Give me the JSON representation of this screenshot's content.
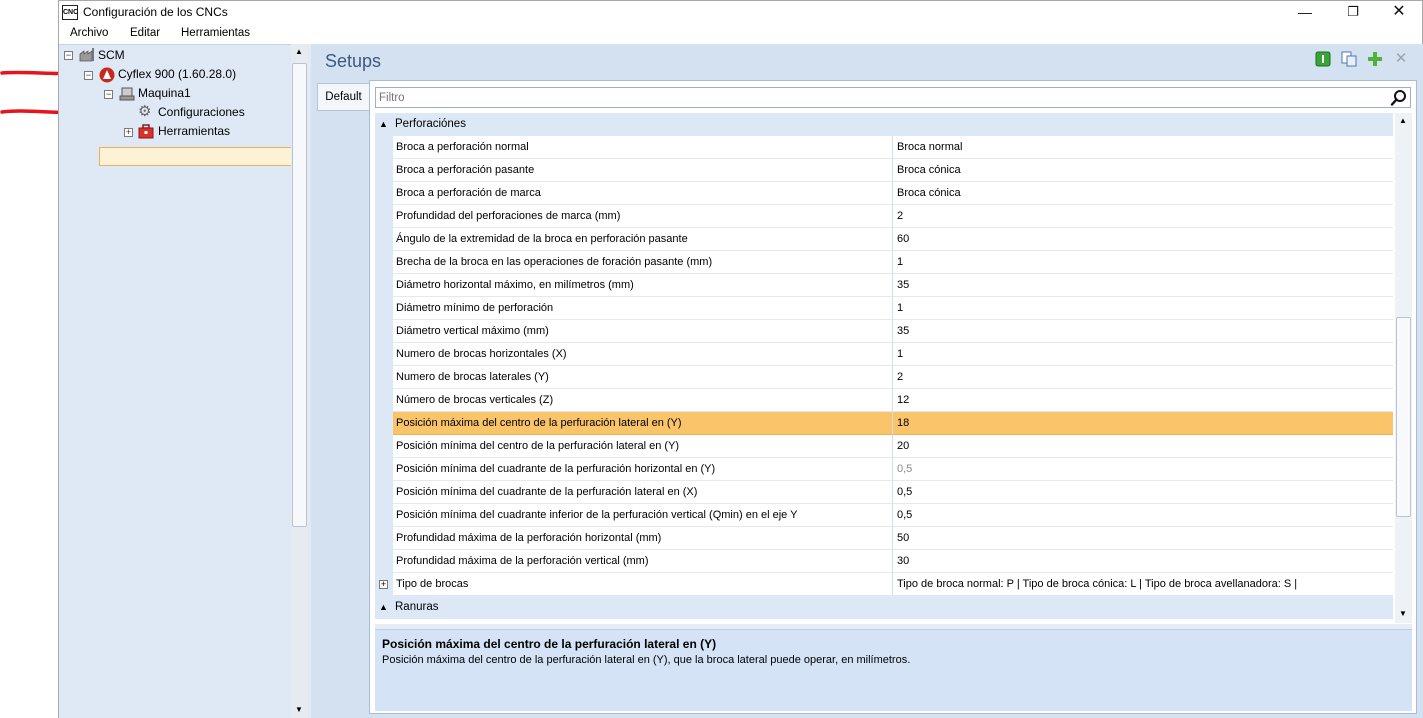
{
  "window": {
    "title": "Configuración de los CNCs",
    "app_icon_text": "CNC"
  },
  "menu": [
    "Archivo",
    "Editar",
    "Herramientas"
  ],
  "tree": {
    "root": "SCM",
    "cyflex": "Cyflex 900 (1.60.28.0)",
    "machine": "Maquina1",
    "configurations": "Configuraciones",
    "tools": "Herramientas"
  },
  "setups": {
    "title": "Setups",
    "tab": "Default",
    "filter_placeholder": "Filtro"
  },
  "grid": {
    "group1": "Perforaciónes",
    "rows": [
      {
        "name": "Broca a perforación normal",
        "value": "Broca normal"
      },
      {
        "name": "Broca a perforación pasante",
        "value": "Broca cónica"
      },
      {
        "name": "Broca a perforación de marca",
        "value": "Broca cónica"
      },
      {
        "name": "Profundidad del perforaciones de marca (mm)",
        "value": "2"
      },
      {
        "name": "Ángulo de la extremidad de la broca en perforación pasante",
        "value": "60"
      },
      {
        "name": "Brecha de la broca en las operaciones de foración pasante (mm)",
        "value": "1"
      },
      {
        "name": "Diámetro horizontal máximo, en milímetros (mm)",
        "value": "35"
      },
      {
        "name": "Diámetro mínimo de perforación",
        "value": "1"
      },
      {
        "name": "Diámetro vertical máximo (mm)",
        "value": "35"
      },
      {
        "name": "Numero de brocas horizontales (X)",
        "value": "1"
      },
      {
        "name": "Numero de brocas laterales (Y)",
        "value": "2"
      },
      {
        "name": "Número de brocas verticales (Z)",
        "value": "12"
      },
      {
        "name": "Posición máxima del centro de la perfuración lateral en (Y)",
        "value": "18"
      },
      {
        "name": "Posición mínima del centro de la perfuración lateral en (Y)",
        "value": "20"
      },
      {
        "name": "Posición mínima del cuadrante de la perfuración horizontal en (Y)",
        "value": "0,5"
      },
      {
        "name": "Posición mínima del cuadrante de la perfuración lateral en (X)",
        "value": "0,5"
      },
      {
        "name": "Posición mínima del cuadrante inferior de la perfuración vertical (Qmin) en el eje Y",
        "value": "0,5"
      },
      {
        "name": "Profundidad máxima de la perforación horizontal (mm)",
        "value": "50"
      },
      {
        "name": "Profundidad máxima de la perforación vertical (mm)",
        "value": "30"
      },
      {
        "name": "Tipo de brocas",
        "value": "Tipo de broca normal: P  |  Tipo de broca cónica: L  |  Tipo de broca avellanadora: S  |"
      }
    ],
    "group2": "Ranuras"
  },
  "description": {
    "title": "Posición máxima del centro de la perfuración lateral en (Y)",
    "text": "Posición máxima del centro de la perfuración lateral en (Y), que la broca lateral puede operar, en milímetros."
  },
  "colors": {
    "selection": "#f9c46a",
    "group_bg": "#dce8f6",
    "pane_bg": "#d4e1f1",
    "arrow": "#e8141b"
  }
}
